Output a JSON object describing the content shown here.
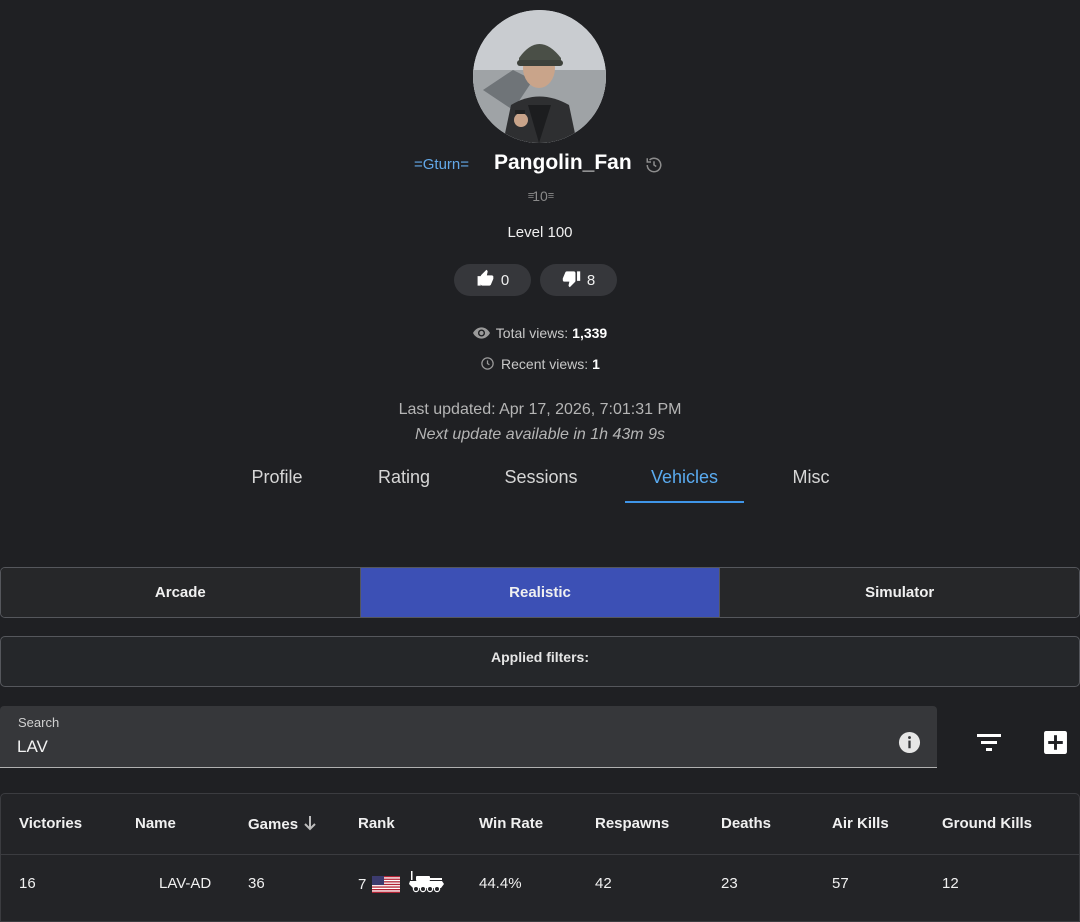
{
  "profile": {
    "clan_tag": "=Gturn=",
    "player_name": "Pangolin_Fan",
    "rank_badge": "10",
    "level": "Level 100",
    "likes": "0",
    "dislikes": "8",
    "total_views_label": "Total views:",
    "total_views_value": "1,339",
    "recent_views_label": "Recent views:",
    "recent_views_value": "1",
    "last_updated": "Last updated: Apr 17, 2026, 7:01:31 PM",
    "next_update": "Next update available in 1h 43m 9s"
  },
  "tabs": [
    {
      "label": "Profile",
      "active": false
    },
    {
      "label": "Rating",
      "active": false
    },
    {
      "label": "Sessions",
      "active": false
    },
    {
      "label": "Vehicles",
      "active": true
    },
    {
      "label": "Misc",
      "active": false
    }
  ],
  "modes": [
    {
      "label": "Arcade",
      "active": false
    },
    {
      "label": "Realistic",
      "active": true
    },
    {
      "label": "Simulator",
      "active": false
    }
  ],
  "filters": {
    "label": "Applied filters:"
  },
  "search": {
    "label": "Search",
    "value": "LAV"
  },
  "table": {
    "headers": {
      "victories": "Victories",
      "name": "Name",
      "games": "Games",
      "rank": "Rank",
      "win_rate": "Win Rate",
      "respawns": "Respawns",
      "deaths": "Deaths",
      "air_kills": "Air Kills",
      "ground_kills": "Ground Kills"
    },
    "sort": {
      "column": "games",
      "direction": "desc"
    },
    "rows": [
      {
        "victories": "16",
        "name": "LAV-AD",
        "games": "36",
        "rank": "7",
        "nation_icon": "usa-flag-icon",
        "vehicle_icon": "tank-icon",
        "win_rate": "44.4%",
        "respawns": "42",
        "deaths": "23",
        "air_kills": "57",
        "ground_kills": "12"
      }
    ]
  },
  "colors": {
    "background": "#1f2023",
    "accent": "#5aabf0",
    "mode_active": "#3c50b5",
    "clan_tag": "#63a8e8"
  }
}
